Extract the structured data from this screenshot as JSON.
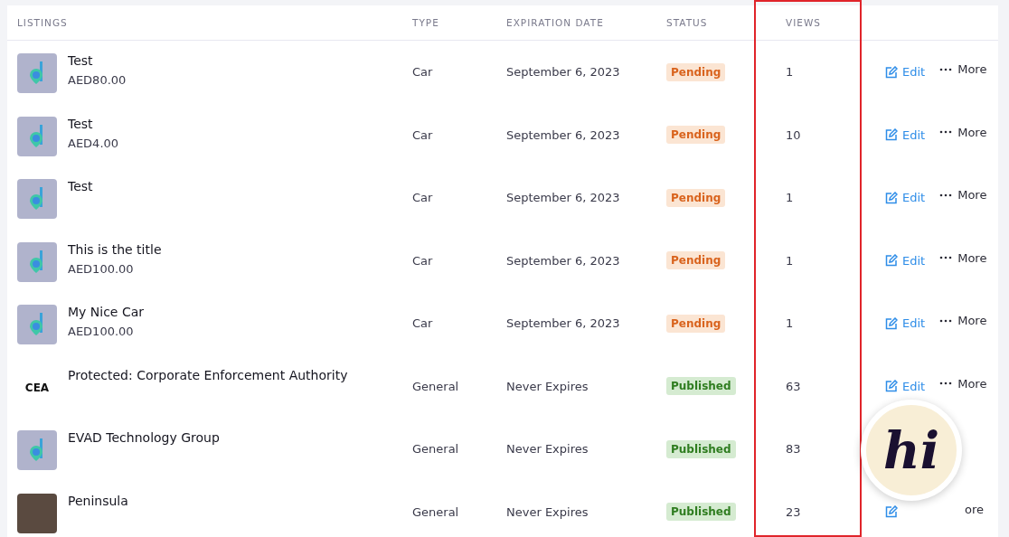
{
  "columns": [
    {
      "label": "LISTINGS",
      "highlighted": false
    },
    {
      "label": "TYPE",
      "highlighted": false
    },
    {
      "label": "EXPIRATION DATE",
      "highlighted": false
    },
    {
      "label": "STATUS",
      "highlighted": false
    },
    {
      "label": "VIEWS",
      "highlighted": true
    }
  ],
  "rows": [
    {
      "kind": "app-logo",
      "title": "Test",
      "price": "AED80.00",
      "type": "Car",
      "expiration": "September 6, 2023",
      "status": {
        "kind": "pending",
        "label": "Pending"
      },
      "views": "1",
      "edit": "Edit",
      "more": "More"
    },
    {
      "kind": "app-logo",
      "title": "Test",
      "price": "AED4.00",
      "type": "Car",
      "expiration": "September 6, 2023",
      "status": {
        "kind": "pending",
        "label": "Pending"
      },
      "views": "10",
      "edit": "Edit",
      "more": "More"
    },
    {
      "kind": "app-logo",
      "title": "Test",
      "type": "Car",
      "expiration": "September 6, 2023",
      "status": {
        "kind": "pending",
        "label": "Pending"
      },
      "views": "1",
      "edit": "Edit",
      "more": "More"
    },
    {
      "kind": "app-logo",
      "title": "This is the title",
      "price": "AED100.00",
      "type": "Car",
      "expiration": "September 6, 2023",
      "status": {
        "kind": "pending",
        "label": "Pending"
      },
      "views": "1",
      "edit": "Edit",
      "more": "More"
    },
    {
      "kind": "app-logo",
      "title": "My Nice Car",
      "price": "AED100.00",
      "type": "Car",
      "expiration": "September 6, 2023",
      "status": {
        "kind": "pending",
        "label": "Pending"
      },
      "views": "1",
      "edit": "Edit",
      "more": "More"
    },
    {
      "kind": "cea-logo",
      "logo_text": "CEA",
      "title": "Protected: Corporate Enforcement Authority",
      "type": "General",
      "expiration": "Never Expires",
      "status": {
        "kind": "published",
        "label": "Published"
      },
      "views": "63",
      "edit": "Edit",
      "more": "More"
    },
    {
      "kind": "app-logo",
      "title": "EVAD Technology Group",
      "type": "General",
      "expiration": "Never Expires",
      "status": {
        "kind": "published",
        "label": "Published"
      },
      "views": "83"
    },
    {
      "kind": "photo",
      "title": "Peninsula",
      "type": "General",
      "expiration": "Never Expires",
      "status": {
        "kind": "published",
        "label": "Published"
      },
      "views": "23",
      "more": "ore"
    }
  ],
  "chat_widget": {
    "label": "hi"
  }
}
